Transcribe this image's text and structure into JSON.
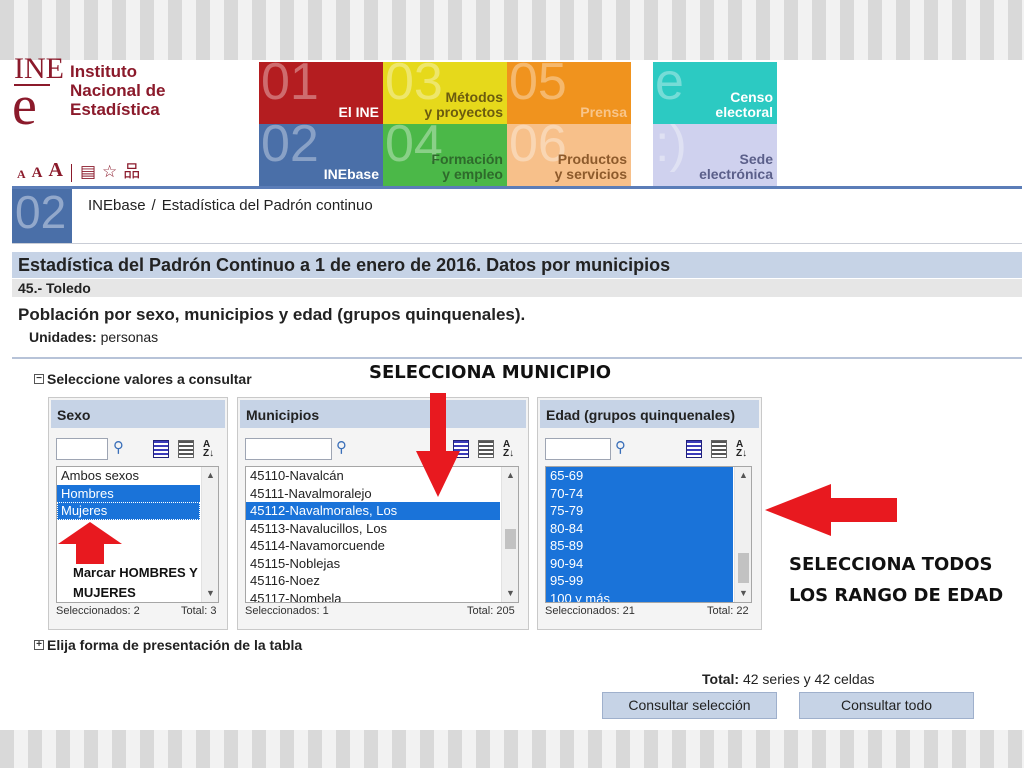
{
  "logo": {
    "mark": "INE",
    "line1": "Instituto",
    "line2": "Nacional de",
    "line3": "Estadística"
  },
  "access": {
    "a_small": "A",
    "a_medium": "A",
    "a_large": "A"
  },
  "tiles": {
    "t01": {
      "num": "01",
      "label": "El INE"
    },
    "t02": {
      "num": "02",
      "label": "INEbase"
    },
    "t03": {
      "num": "03",
      "label1": "Métodos",
      "label2": "y proyectos"
    },
    "t04": {
      "num": "04",
      "label1": "Formación",
      "label2": "y empleo"
    },
    "t05": {
      "num": "05",
      "label": "Prensa"
    },
    "t06": {
      "num": "06",
      "label1": "Productos",
      "label2": "y servicios"
    },
    "censo": {
      "num": "e",
      "label1": "Censo",
      "label2": "electoral"
    },
    "sede": {
      "num": ":)",
      "label1": "Sede",
      "label2": "electrónica"
    }
  },
  "breadcrumb": {
    "box_num": "02",
    "item1": "INEbase",
    "sep": "/",
    "item2": "Estadística del Padrón continuo"
  },
  "page": {
    "title": "Estadística del Padrón Continuo a 1 de enero de 2016. Datos por municipios",
    "subtitle": "45.- Toledo",
    "table_title": "Población por sexo, municipios y edad (grupos quinquenales).",
    "units_label": "Unidades:",
    "units_value": "personas"
  },
  "toggles": {
    "select_values": "Seleccione valores a consultar",
    "select_values_sign": "−",
    "presentation": "Elija forma de presentación de la tabla",
    "presentation_sign": "+"
  },
  "panels": {
    "sexo": {
      "title": "Sexo",
      "items": [
        {
          "label": "Ambos sexos",
          "selected": false
        },
        {
          "label": "Hombres",
          "selected": true
        },
        {
          "label": "Mujeres",
          "selected": true
        }
      ],
      "selected_label": "Seleccionados: 2",
      "total_label": "Total: 3"
    },
    "municipios": {
      "title": "Municipios",
      "items": [
        {
          "label": "45110-Navalcán",
          "selected": false
        },
        {
          "label": "45111-Navalmoralejo",
          "selected": false
        },
        {
          "label": "45112-Navalmorales, Los",
          "selected": true
        },
        {
          "label": "45113-Navalucillos, Los",
          "selected": false
        },
        {
          "label": "45114-Navamorcuende",
          "selected": false
        },
        {
          "label": "45115-Noblejas",
          "selected": false
        },
        {
          "label": "45116-Noez",
          "selected": false
        },
        {
          "label": "45117-Nombela",
          "selected": false
        }
      ],
      "selected_label": "Seleccionados: 1",
      "total_label": "Total: 205"
    },
    "edad": {
      "title": "Edad (grupos quinquenales)",
      "items": [
        {
          "label": "65-69",
          "selected": true
        },
        {
          "label": "70-74",
          "selected": true
        },
        {
          "label": "75-79",
          "selected": true
        },
        {
          "label": "80-84",
          "selected": true
        },
        {
          "label": "85-89",
          "selected": true
        },
        {
          "label": "90-94",
          "selected": true
        },
        {
          "label": "95-99",
          "selected": true
        },
        {
          "label": "100 y más",
          "selected": true
        }
      ],
      "selected_label": "Seleccionados: 21",
      "total_label": "Total: 22"
    }
  },
  "annotations": {
    "select_municipio": "SELECCIONA MUNICIPIO",
    "select_ages_line1": "SELECCIONA TODOS",
    "select_ages_line2": "LOS RANGO DE EDAD",
    "mark_line1": "Marcar HOMBRES Y",
    "mark_line2": "MUJERES",
    "arrow_color": "#e8191f"
  },
  "summary": {
    "total_label": "Total:",
    "total_value": "42 series y 42 celdas"
  },
  "buttons": {
    "consult_selection": "Consultar selección",
    "consult_all": "Consultar todo"
  }
}
